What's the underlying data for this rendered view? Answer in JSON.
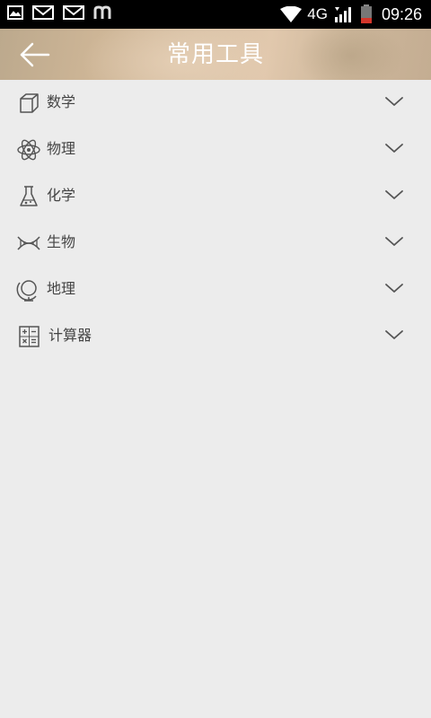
{
  "status_bar": {
    "network": "4G",
    "time": "09:26",
    "left_icons": [
      "gallery-icon",
      "mail-icon",
      "mail-icon",
      "m-app-icon"
    ],
    "right_icons": [
      "wifi-icon",
      "signal-icon",
      "battery-icon"
    ]
  },
  "header": {
    "title": "常用工具",
    "back_icon": "arrow-left-icon"
  },
  "tools": [
    {
      "label": "数学",
      "icon": "cube-icon"
    },
    {
      "label": "物理",
      "icon": "atom-icon"
    },
    {
      "label": "化学",
      "icon": "flask-icon"
    },
    {
      "label": "生物",
      "icon": "dna-icon"
    },
    {
      "label": "地理",
      "icon": "globe-icon"
    },
    {
      "label": "计算器",
      "icon": "calculator-icon"
    }
  ],
  "colors": {
    "background": "#ececec",
    "text": "#444444",
    "icon": "#555555",
    "status_bar": "#000000"
  }
}
